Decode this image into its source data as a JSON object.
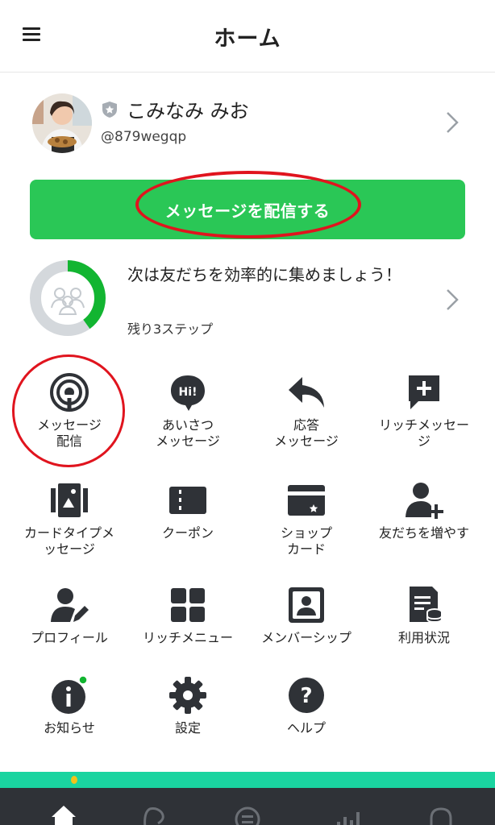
{
  "header": {
    "title": "ホーム"
  },
  "account": {
    "name": "こみなみ みお",
    "id": "@879wegqp"
  },
  "broadcast": {
    "label": "メッセージを配信する"
  },
  "progress": {
    "text": "次は友だちを効率的に集めましょう！",
    "sub": "残り3ステップ",
    "fraction": 0.4
  },
  "menu": [
    {
      "label": "メッセージ\n配信",
      "icon": "broadcast-icon"
    },
    {
      "label": "あいさつ\nメッセージ",
      "icon": "greeting-icon"
    },
    {
      "label": "応答\nメッセージ",
      "icon": "reply-icon"
    },
    {
      "label": "リッチメッセー\nジ",
      "icon": "rich-message-icon"
    },
    {
      "label": "カードタイプメ\nッセージ",
      "icon": "card-type-icon"
    },
    {
      "label": "クーポン",
      "icon": "coupon-icon"
    },
    {
      "label": "ショップ\nカード",
      "icon": "shop-card-icon"
    },
    {
      "label": "友だちを増やす",
      "icon": "add-friend-icon"
    },
    {
      "label": "プロフィール",
      "icon": "profile-icon"
    },
    {
      "label": "リッチメニュー",
      "icon": "rich-menu-icon"
    },
    {
      "label": "メンバーシップ",
      "icon": "membership-icon"
    },
    {
      "label": "利用状況",
      "icon": "usage-icon"
    },
    {
      "label": "お知らせ",
      "icon": "info-icon"
    },
    {
      "label": "設定",
      "icon": "gear-icon"
    },
    {
      "label": "ヘルプ",
      "icon": "help-icon"
    }
  ],
  "colors": {
    "accent_green": "#2ac756",
    "annotation_red": "#e0141e",
    "nav_bg": "#2f3237",
    "icon_dark": "#2f3237"
  }
}
